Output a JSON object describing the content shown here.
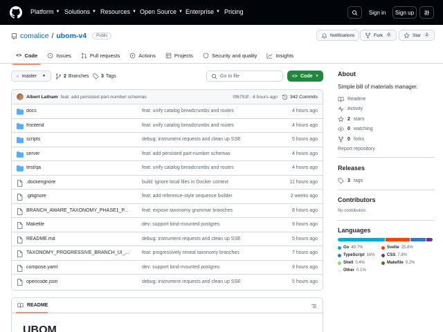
{
  "nav": {
    "items": [
      "Platform",
      "Solutions",
      "Resources",
      "Open Source",
      "Enterprise",
      "Pricing"
    ],
    "sign_in": "Sign in",
    "sign_up": "Sign up"
  },
  "repo": {
    "owner": "comalice",
    "name": "ubom-v4",
    "visibility": "Public",
    "notifications": "Notifications",
    "fork_label": "Fork",
    "fork_count": "0",
    "star_label": "Star",
    "star_count": "2"
  },
  "tabs": [
    "Code",
    "Issues",
    "Pull requests",
    "Actions",
    "Projects",
    "Security and quality",
    "Insights"
  ],
  "branchbar": {
    "branch": "master",
    "branches_count": "2",
    "branches_label": "Branches",
    "tags_count": "3",
    "tags_label": "Tags",
    "search_placeholder": "Go to file",
    "code_label": "Code"
  },
  "commit": {
    "author": "Albert Latham",
    "message": "feat: add persisted part-number schemas",
    "hash": "0f6753f",
    "time": "· 4 hours ago",
    "commits": "342 Commits"
  },
  "files": [
    {
      "name": "docs",
      "type": "dir",
      "msg": "feat: unify catalog breadcrumbs and routes",
      "date": "4 hours ago"
    },
    {
      "name": "frontend",
      "type": "dir",
      "msg": "feat: unify catalog breadcrumbs and routes",
      "date": "4 hours ago"
    },
    {
      "name": "scripts",
      "type": "dir",
      "msg": "debug: instrument requests and clean up SSE",
      "date": "5 hours ago"
    },
    {
      "name": "server",
      "type": "dir",
      "msg": "feat: add persisted part-number schemas",
      "date": "4 hours ago"
    },
    {
      "name": "test/qa",
      "type": "dir",
      "msg": "feat: unify catalog breadcrumbs and routes",
      "date": "4 hours ago"
    },
    {
      "name": ".dockerignore",
      "type": "file",
      "msg": "build: ignore local files in Docker context",
      "date": "11 hours ago"
    },
    {
      "name": ".gitignore",
      "type": "file",
      "msg": "feat: add reference-style sequence builder",
      "date": "2 weeks ago"
    },
    {
      "name": "BRANCH_AWARE_TAXONOMY_PHASE1_P...",
      "type": "file",
      "msg": "feat: expose taxonomy grammar branches",
      "date": "8 hours ago"
    },
    {
      "name": "Makefile",
      "type": "file",
      "msg": "dev: support bind-mounted postgres",
      "date": "9 hours ago"
    },
    {
      "name": "README.md",
      "type": "file",
      "msg": "debug: instrument requests and clean up SSE",
      "date": "5 hours ago"
    },
    {
      "name": "TAXONOMY_PROGRESSIVE_BRANCH_UI_...",
      "type": "file",
      "msg": "feat: progressively reveal taxonomy branches",
      "date": "7 hours ago"
    },
    {
      "name": "compose.yaml",
      "type": "file",
      "msg": "dev: support bind-mounted postgres",
      "date": "9 hours ago"
    },
    {
      "name": "opencode.json",
      "type": "file",
      "msg": "debug: instrument requests and clean up SSE",
      "date": "5 hours ago"
    }
  ],
  "readme": {
    "tab": "README",
    "title": "UBOM"
  },
  "about": {
    "heading": "About",
    "description": "Simple bill of materials manager.",
    "readme": "Readme",
    "activity": "Activity",
    "stars_count": "2",
    "stars_label": "stars",
    "watching_count": "0",
    "watching_label": "watching",
    "forks_count": "0",
    "forks_label": "forks",
    "report": "Report repository"
  },
  "releases": {
    "heading": "Releases",
    "tags_count": "3",
    "tags_label": "tags"
  },
  "contributors": {
    "heading": "Contributors",
    "empty": "No contributors"
  },
  "languages": {
    "heading": "Languages",
    "items": [
      {
        "name": "Go",
        "pct": "49.7%",
        "value": 49.7,
        "color": "#00ADD8"
      },
      {
        "name": "Svelte",
        "pct": "25.8%",
        "value": 25.8,
        "color": "#ff3e00"
      },
      {
        "name": "TypeScript",
        "pct": "16%",
        "value": 16,
        "color": "#3178c6"
      },
      {
        "name": "CSS",
        "pct": "7.8%",
        "value": 7.8,
        "color": "#663399"
      },
      {
        "name": "Shell",
        "pct": "0.4%",
        "value": 0.4,
        "color": "#89e051"
      },
      {
        "name": "Makefile",
        "pct": "0.2%",
        "value": 0.2,
        "color": "#427819"
      },
      {
        "name": "Other",
        "pct": "0.1%",
        "value": 0.1,
        "color": "#ededed"
      }
    ]
  }
}
